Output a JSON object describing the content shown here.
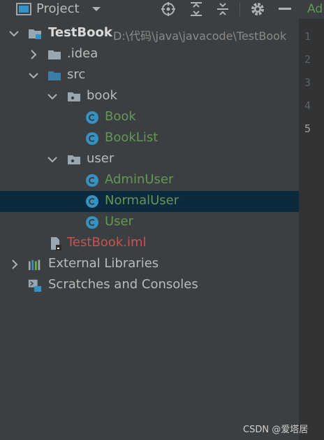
{
  "toolbar": {
    "title": "Project",
    "icons": [
      "project-window-icon",
      "dropdown-icon",
      "locate-icon",
      "expand-all-icon",
      "collapse-all-icon",
      "settings-icon",
      "hide-icon"
    ]
  },
  "tree": {
    "root": {
      "label": "TestBook",
      "path": "D:\\代码\\java\\javacode\\TestBook"
    },
    "idea": {
      "label": ".idea"
    },
    "src": {
      "label": "src"
    },
    "book": {
      "label": "book"
    },
    "book_cls": {
      "label": "Book"
    },
    "booklist_cls": {
      "label": "BookList"
    },
    "user": {
      "label": "user"
    },
    "adminuser_cls": {
      "label": "AdminUser"
    },
    "normaluser_cls": {
      "label": "NormalUser"
    },
    "user_cls": {
      "label": "User"
    },
    "iml": {
      "label": "TestBook.iml"
    },
    "ext_libs": {
      "label": "External Libraries"
    },
    "scratches": {
      "label": "Scratches and Consoles"
    }
  },
  "editor": {
    "tab_label": "Ad",
    "line_numbers": [
      "1",
      "2",
      "3",
      "4",
      "5"
    ],
    "current_line": "5"
  },
  "watermark": "CSDN @爱塔居",
  "colors": {
    "selection": "#0d293e",
    "class_text": "#629755",
    "iml_text": "#c75450",
    "class_icon": "#3592c4",
    "folder_blue": "#3d7ea6"
  }
}
